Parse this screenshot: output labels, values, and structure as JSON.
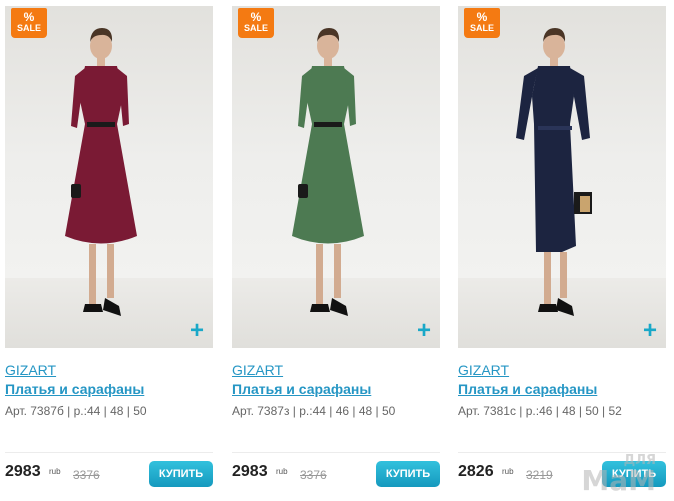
{
  "badge": {
    "percent": "%",
    "text": "SALE"
  },
  "add_symbol": "+",
  "buy_label": "КУПИТЬ",
  "currency": "rub",
  "watermark": {
    "line1": "ДЛЯ",
    "line2": "MaM"
  },
  "products": [
    {
      "brand": "GIZART",
      "category": "Платья и сарафаны",
      "article": "Арт. 7387б | р.:44 | 48 | 50",
      "price": "2983",
      "old_price": "3376",
      "dress_color": "#7a1a34"
    },
    {
      "brand": "GIZART",
      "category": "Платья и сарафаны",
      "article": "Арт. 7387з | р.:44 | 46 | 48 | 50",
      "price": "2983",
      "old_price": "3376",
      "dress_color": "#4d7a52"
    },
    {
      "brand": "GIZART",
      "category": "Платья и сарафаны",
      "article": "Арт. 7381с | р.:46 | 48 | 50 | 52",
      "price": "2826",
      "old_price": "3219",
      "dress_color": "#1c2440"
    }
  ]
}
